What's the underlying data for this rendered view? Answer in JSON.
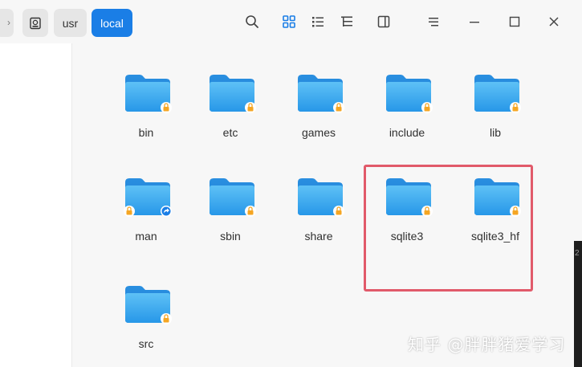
{
  "breadcrumb": {
    "items": [
      {
        "label": "usr"
      },
      {
        "label": "local"
      }
    ]
  },
  "folders": [
    {
      "name": "bin",
      "badge": "lock"
    },
    {
      "name": "etc",
      "badge": "lock"
    },
    {
      "name": "games",
      "badge": "lock"
    },
    {
      "name": "include",
      "badge": "lock"
    },
    {
      "name": "lib",
      "badge": "lock"
    },
    {
      "name": "man",
      "badge": "lock+link"
    },
    {
      "name": "sbin",
      "badge": "lock"
    },
    {
      "name": "share",
      "badge": "lock"
    },
    {
      "name": "sqlite3",
      "badge": "lock"
    },
    {
      "name": "sqlite3_hf",
      "badge": "lock"
    },
    {
      "name": "src",
      "badge": "lock"
    }
  ],
  "watermark": {
    "text": "知乎 @胖胖猪爱学习"
  },
  "colors": {
    "accent": "#1a7ee6",
    "folder_light": "#63c3f5",
    "folder_dark": "#1f8fe0",
    "lock": "#f5a623",
    "highlight": "#e15a6a"
  },
  "icons": {
    "toolbar": [
      "search-icon",
      "grid-view-icon",
      "list-view-icon",
      "tree-view-icon",
      "sidebar-toggle-icon",
      "menu-icon",
      "minimize-icon",
      "maximize-icon",
      "close-icon"
    ]
  },
  "edge_text": "2"
}
